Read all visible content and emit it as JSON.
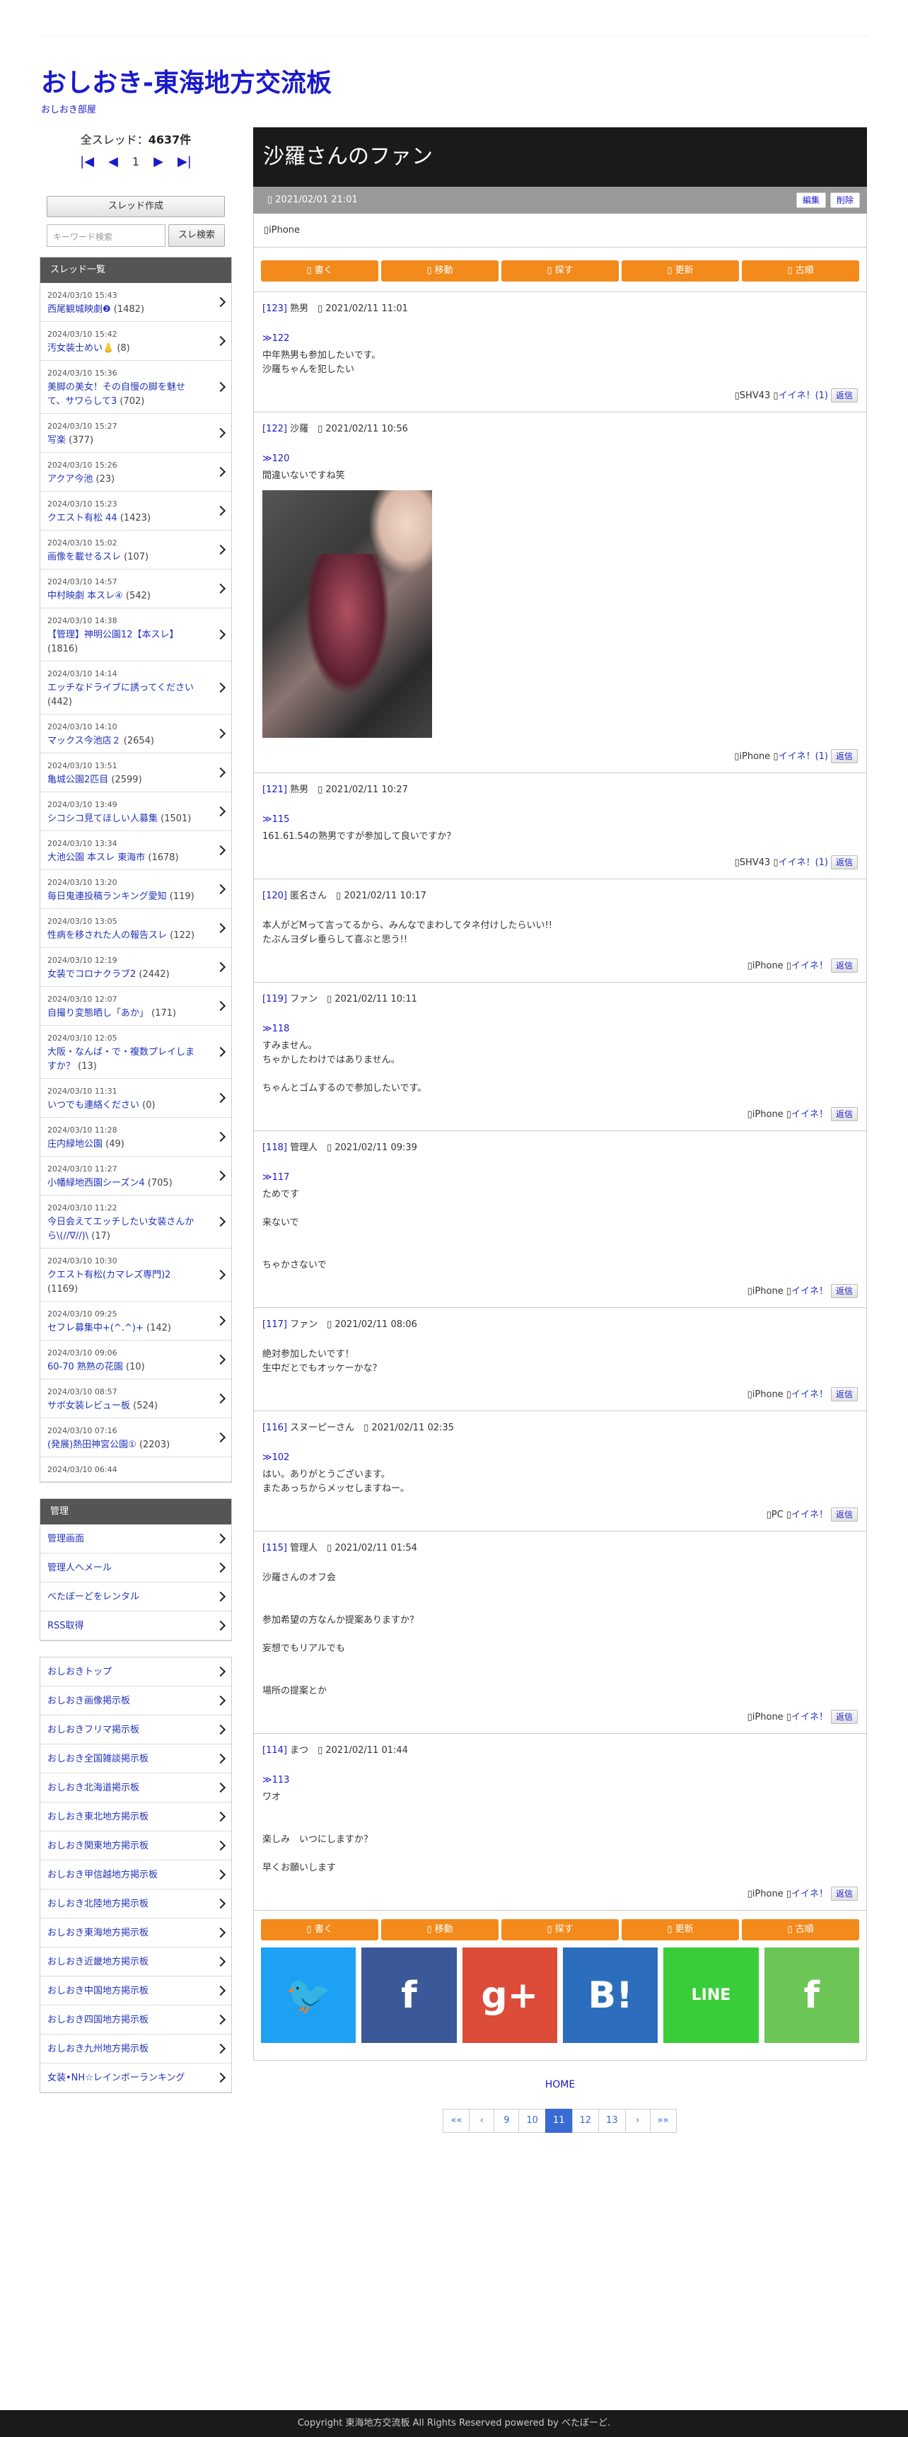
{
  "site": {
    "title": "おしおき-東海地方交流板",
    "subtitle": "おしおき部屋"
  },
  "counter": {
    "label": "全スレッド：",
    "value": "4637件",
    "page": "1"
  },
  "sidebar": {
    "create_label": "スレッド作成",
    "search_placeholder": "キーワード検索",
    "search_button": "スレ検索",
    "threads_header": "スレッド一覧",
    "threads": [
      {
        "date": "2024/03/10 15:43",
        "title": "西尾観城映劇❷",
        "count": "(1482)"
      },
      {
        "date": "2024/03/10 15:42",
        "title": "汚女装士めい👃",
        "count": "(8)"
      },
      {
        "date": "2024/03/10 15:36",
        "title": "美脚の美女！その自慢の脚を魅せて、サワらして3",
        "count": "(702)"
      },
      {
        "date": "2024/03/10 15:27",
        "title": "写楽",
        "count": "(377)"
      },
      {
        "date": "2024/03/10 15:26",
        "title": "アクア今池",
        "count": "(23)"
      },
      {
        "date": "2024/03/10 15:23",
        "title": "クエスト有松 44",
        "count": "(1423)"
      },
      {
        "date": "2024/03/10 15:02",
        "title": "画像を載せるスレ",
        "count": "(107)"
      },
      {
        "date": "2024/03/10 14:57",
        "title": "中村映劇 本スレ④",
        "count": "(542)"
      },
      {
        "date": "2024/03/10 14:38",
        "title": "【管理】神明公園12【本スレ】",
        "count": "(1816)"
      },
      {
        "date": "2024/03/10 14:14",
        "title": "エッチなドライブに誘ってください",
        "count": "(442)"
      },
      {
        "date": "2024/03/10 14:10",
        "title": "マックス今池店２",
        "count": "(2654)"
      },
      {
        "date": "2024/03/10 13:51",
        "title": "亀城公園2匹目",
        "count": "(2599)"
      },
      {
        "date": "2024/03/10 13:49",
        "title": "シコシコ見てほしい人募集",
        "count": "(1501)"
      },
      {
        "date": "2024/03/10 13:34",
        "title": "大池公園 本スレ 東海市",
        "count": "(1678)"
      },
      {
        "date": "2024/03/10 13:20",
        "title": "毎日鬼連投稿ランキング愛知",
        "count": "(119)"
      },
      {
        "date": "2024/03/10 13:05",
        "title": "性病を移された人の報告スレ",
        "count": "(122)"
      },
      {
        "date": "2024/03/10 12:19",
        "title": "女装でコロナクラブ2",
        "count": "(2442)"
      },
      {
        "date": "2024/03/10 12:07",
        "title": "自撮り変態晒し「あか」",
        "count": "(171)"
      },
      {
        "date": "2024/03/10 12:05",
        "title": "大阪・なんば・で・複数プレイしますか？",
        "count": "(13)"
      },
      {
        "date": "2024/03/10 11:31",
        "title": "いつでも連絡ください",
        "count": "(0)"
      },
      {
        "date": "2024/03/10 11:28",
        "title": "庄内緑地公園",
        "count": "(49)"
      },
      {
        "date": "2024/03/10 11:27",
        "title": "小幡緑地西園シーズン4",
        "count": "(705)"
      },
      {
        "date": "2024/03/10 11:22",
        "title": "今日会えてエッチしたい女装さんから\\(//∇//)\\",
        "count": "(17)"
      },
      {
        "date": "2024/03/10 10:30",
        "title": "クエスト有松(カマレズ専門)2",
        "count": "(1169)"
      },
      {
        "date": "2024/03/10 09:25",
        "title": "セフレ募集中+(^.^)+",
        "count": "(142)"
      },
      {
        "date": "2024/03/10 09:06",
        "title": "60-70 熟熟の花園",
        "count": "(10)"
      },
      {
        "date": "2024/03/10 08:57",
        "title": "サボ女装レビュー板",
        "count": "(524)"
      },
      {
        "date": "2024/03/10 07:16",
        "title": "(発展)熱田神宮公園①",
        "count": "(2203)"
      },
      {
        "date": "2024/03/10 06:44",
        "title": "",
        "count": ""
      }
    ],
    "admin_header": "管理",
    "admin_items": [
      "管理画面",
      "管理人へメール",
      "べたぼーどをレンタル",
      "RSS取得"
    ],
    "links": [
      "おしおきトップ",
      "おしおき画像掲示板",
      "おしおきフリマ掲示板",
      "おしおき全国雑談掲示板",
      "おしおき北海道掲示板",
      "おしおき東北地方掲示板",
      "おしおき関東地方掲示板",
      "おしおき甲信越地方掲示板",
      "おしおき北陸地方掲示板",
      "おしおき東海地方掲示板",
      "おしおき近畿地方掲示板",
      "おしおき中国地方掲示板",
      "おしおき四国地方掲示板",
      "おしおき九州地方掲示板",
      "女装•NH☆レインボーランキング"
    ]
  },
  "thread": {
    "title": "沙羅さんのファン",
    "date": "2021/02/01 21:01",
    "edit": "編集",
    "delete": "削除",
    "op_device": "iPhone"
  },
  "actions": [
    "書く",
    "移動",
    "探す",
    "更新",
    "古順"
  ],
  "posts": [
    {
      "num": "[123]",
      "name": "熟男",
      "date": "2021/02/11 11:01",
      "ref": "≫122",
      "body": "中年熟男も参加したいです。\n沙羅ちゃんを犯したい",
      "device": "SHV43",
      "like": "イイネ！(1)",
      "photo": false
    },
    {
      "num": "[122]",
      "name": "沙羅",
      "date": "2021/02/11 10:56",
      "ref": "≫120",
      "body": "間違いないですね笑",
      "device": "iPhone",
      "like": "イイネ！(1)",
      "photo": true
    },
    {
      "num": "[121]",
      "name": "熟男",
      "date": "2021/02/11 10:27",
      "ref": "≫115",
      "body": "161.61.54の熟男ですが参加して良いですか？",
      "device": "SHV43",
      "like": "イイネ！(1)",
      "photo": false
    },
    {
      "num": "[120]",
      "name": "匿名さん",
      "date": "2021/02/11 10:17",
      "ref": "",
      "body": "本人がどMって言ってるから、みんなでまわしてタネ付けしたらいい!!\nたぶんヨダレ垂らして喜ぶと思う!!",
      "device": "iPhone",
      "like": "イイネ！",
      "photo": false
    },
    {
      "num": "[119]",
      "name": "ファン",
      "date": "2021/02/11 10:11",
      "ref": "≫118",
      "body": "すみません。\nちゃかしたわけではありません。\n\nちゃんとゴムするので参加したいです。",
      "device": "iPhone",
      "like": "イイネ！",
      "photo": false
    },
    {
      "num": "[118]",
      "name": "管理人",
      "date": "2021/02/11 09:39",
      "ref": "≫117",
      "body": "ためです\n\n来ないで\n\n\nちゃかさないで",
      "device": "iPhone",
      "like": "イイネ！",
      "photo": false
    },
    {
      "num": "[117]",
      "name": "ファン",
      "date": "2021/02/11 08:06",
      "ref": "",
      "body": "絶対参加したいです！\n生中だとでもオッケーかな？",
      "device": "iPhone",
      "like": "イイネ！",
      "photo": false
    },
    {
      "num": "[116]",
      "name": "スヌーピーさん",
      "date": "2021/02/11 02:35",
      "ref": "≫102",
      "body": "はい。ありがとうございます。\nまたあっちからメッセしますねー。",
      "device": "PC",
      "like": "イイネ！",
      "photo": false
    },
    {
      "num": "[115]",
      "name": "管理人",
      "date": "2021/02/11 01:54",
      "ref": "",
      "body": "沙羅さんのオフ会\n\n\n参加希望の方なんか提案ありますか？\n\n妄想でもリアルでも\n\n\n場所の提案とか",
      "device": "iPhone",
      "like": "イイネ！",
      "photo": false
    },
    {
      "num": "[114]",
      "name": "まつ",
      "date": "2021/02/11 01:44",
      "ref": "≫113",
      "body": "ワオ\n\n\n楽しみ　いつにしますか？\n\n早くお願いします",
      "device": "iPhone",
      "like": "イイネ！",
      "photo": false
    }
  ],
  "reply_label": "返信",
  "share": [
    {
      "name": "twitter-icon",
      "color": "#1da1f2",
      "label": "🐦"
    },
    {
      "name": "facebook-icon",
      "color": "#3b5998",
      "label": "f"
    },
    {
      "name": "googleplus-icon",
      "color": "#dd4b39",
      "label": "g+"
    },
    {
      "name": "hatena-icon",
      "color": "#2c6ebd",
      "label": "B!"
    },
    {
      "name": "line-icon",
      "color": "#3acd3a",
      "label": "LINE"
    },
    {
      "name": "feedly-icon",
      "color": "#6cc655",
      "label": "f"
    }
  ],
  "home_label": "HOME",
  "pager": [
    "««",
    "‹",
    "9",
    "10",
    "11",
    "12",
    "13",
    "›",
    "»»"
  ],
  "pager_current": "11",
  "footer": "Copyright 東海地方交流板 All Rights Reserved powered by べたぼーど."
}
